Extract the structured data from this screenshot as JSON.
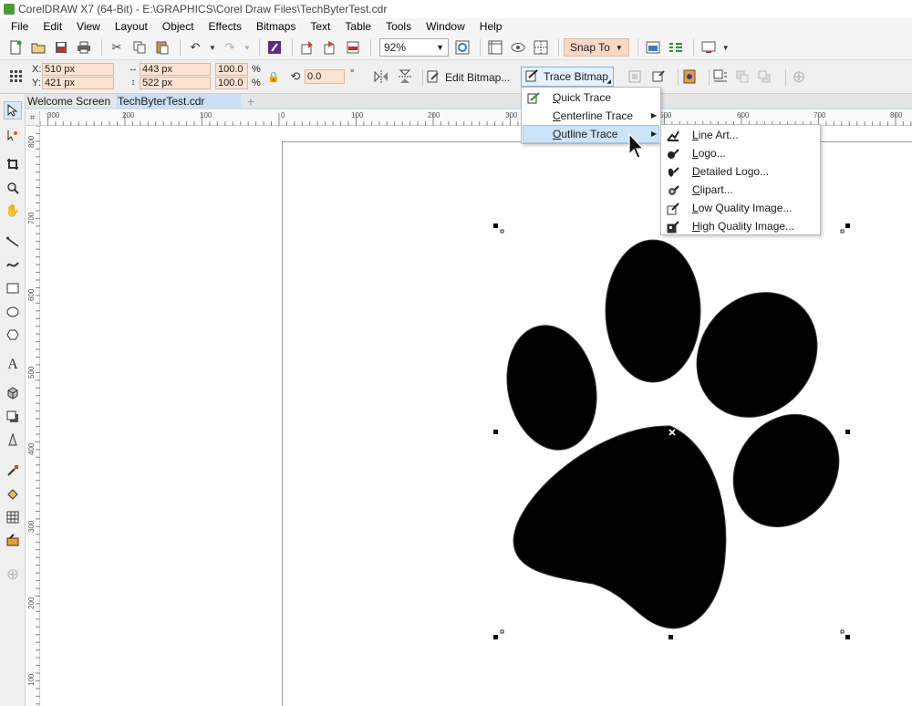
{
  "window": {
    "title": "CorelDRAW X7 (64-Bit) - E:\\GRAPHICS\\Corel Draw Files\\TechByterTest.cdr"
  },
  "menubar": {
    "items": [
      {
        "label": "File"
      },
      {
        "label": "Edit"
      },
      {
        "label": "View"
      },
      {
        "label": "Layout"
      },
      {
        "label": "Object"
      },
      {
        "label": "Effects"
      },
      {
        "label": "Bitmaps"
      },
      {
        "label": "Text"
      },
      {
        "label": "Table"
      },
      {
        "label": "Tools"
      },
      {
        "label": "Window"
      },
      {
        "label": "Help"
      }
    ]
  },
  "standard_toolbar": {
    "zoom_value": "92%",
    "snap_to_label": "Snap To"
  },
  "property_bar": {
    "x_label": "X:",
    "x_value": "510 px",
    "y_label": "Y:",
    "y_value": "421 px",
    "width_value": "443 px",
    "height_value": "522 px",
    "scale_w": "100.0",
    "scale_h": "100.0",
    "percent": "%",
    "rotation_value": "0.0",
    "degree": "°",
    "edit_bitmap_label": "Edit Bitmap...",
    "trace_bitmap_label": "Trace Bitmap"
  },
  "doc_tabs": [
    {
      "label": "Welcome Screen"
    },
    {
      "label": "TechByterTest.cdr"
    }
  ],
  "doc_tab_add": "+",
  "ruler": {
    "h_labels": [
      "300",
      "200",
      "100",
      "0",
      "100",
      "200",
      "300",
      "400",
      "500",
      "600",
      "700",
      "800"
    ],
    "v_labels": [
      "800",
      "700",
      "600",
      "500",
      "400",
      "300",
      "200",
      "100"
    ]
  },
  "trace_menu": {
    "items": [
      {
        "label": "Quick Trace",
        "mnemonic": "Q",
        "rest": "uick Trace"
      },
      {
        "label": "Centerline Trace",
        "mnemonic": "C",
        "rest": "enterline Trace"
      },
      {
        "label": "Outline Trace",
        "mnemonic": "O",
        "rest": "utline Trace"
      }
    ]
  },
  "outline_submenu": {
    "items": [
      {
        "label": "Line Art...",
        "mnemonic": "L",
        "rest": "ine Art..."
      },
      {
        "label": "Logo...",
        "mnemonic": "L",
        "rest": "ogo..."
      },
      {
        "label": "Detailed Logo...",
        "mnemonic": "D",
        "rest": "etailed Logo..."
      },
      {
        "label": "Clipart...",
        "mnemonic": "C",
        "rest": "lipart..."
      },
      {
        "label": "Low Quality Image...",
        "mnemonic": "L",
        "rest": "ow Quality Image..."
      },
      {
        "label": "High Quality Image...",
        "mnemonic": "H",
        "rest": "igh Quality Image..."
      }
    ]
  },
  "colors": {
    "field_bg": "#fde3d2",
    "highlight": "#cce4f7",
    "tab_active": "#cbe0f4"
  }
}
